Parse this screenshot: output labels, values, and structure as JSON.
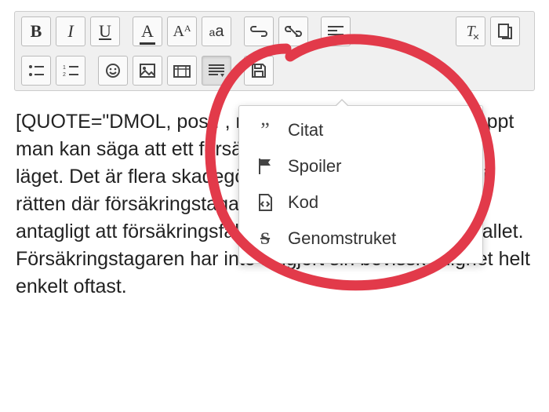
{
  "toolbar": {
    "bold": "B",
    "italic": "I",
    "underline": "U",
    "fontcolor": "A",
    "fontsize_big": "A",
    "fontsize_small": "A",
    "fontfamily_low": "a",
    "fontfamily_up": "a"
  },
  "dropdown": {
    "items": [
      {
        "label": "Citat"
      },
      {
        "label": "Spoiler"
      },
      {
        "label": "Kod"
      },
      {
        "label": "Genomstruket"
      }
    ]
  },
  "editor": {
    "text": "[QUOTE=\"DMOL, post: , member: 155726\"]Det är knappt man kan säga att ett försäkringsfall föreligger i det här läget. Det är flera skadegörare som förlorat genom år i rätten där försäkringstagaren inte har gjort det mer antagligt att försäkringsfall föreligger än att så inte är fallet. Försäkringstagaren har inte fullgjort sin bevisskyldighet helt enkelt oftast."
  }
}
